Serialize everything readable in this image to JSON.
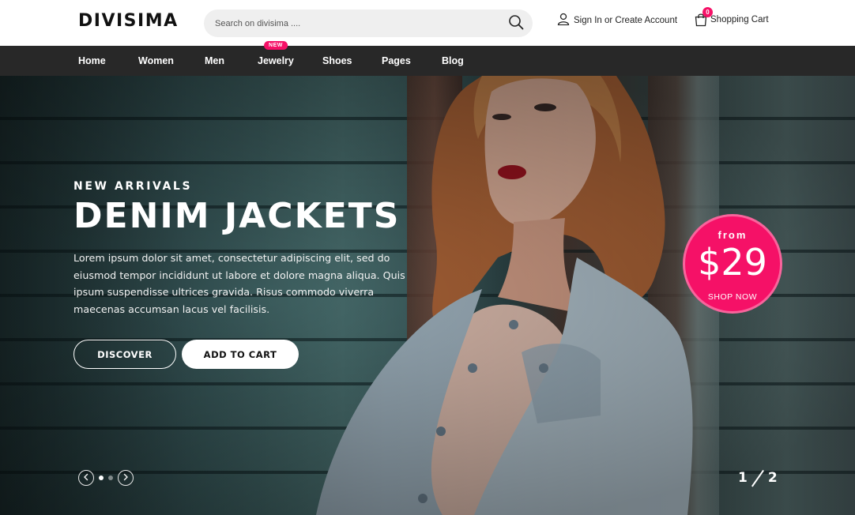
{
  "header": {
    "logo_text": "DIVISIMA",
    "search_placeholder": "Search on divisima ....",
    "account_label": "Sign In or Create Account",
    "cart_label": "Shopping Cart",
    "cart_count": "0"
  },
  "nav": {
    "items": [
      {
        "label": "Home"
      },
      {
        "label": "Women"
      },
      {
        "label": "Men"
      },
      {
        "label": "Jewelry",
        "badge": "NEW"
      },
      {
        "label": "Shoes"
      },
      {
        "label": "Pages"
      },
      {
        "label": "Blog"
      }
    ]
  },
  "hero": {
    "eyebrow": "NEW ARRIVALS",
    "headline": "DENIM JACKETS",
    "description": "Lorem ipsum dolor sit amet, consectetur adipiscing elit, sed do eiusmod tempor incididunt ut labore et dolore magna aliqua. Quis ipsum suspendisse ultrices gravida. Risus commodo viverra maecenas accumsan lacus vel facilisis.",
    "discover_label": "DISCOVER",
    "add_to_cart_label": "ADD TO CART",
    "slide_current": "1",
    "slide_total": "2"
  },
  "promo": {
    "from_label": "from",
    "price": "$29",
    "shop_label": "SHOP NOW"
  },
  "colors": {
    "accent": "#f51167",
    "nav_bg": "#282828"
  },
  "icons": {
    "search": "search-icon",
    "user": "user-icon",
    "cart": "shopping-bag-icon",
    "prev": "chevron-left-icon",
    "next": "chevron-right-icon"
  }
}
